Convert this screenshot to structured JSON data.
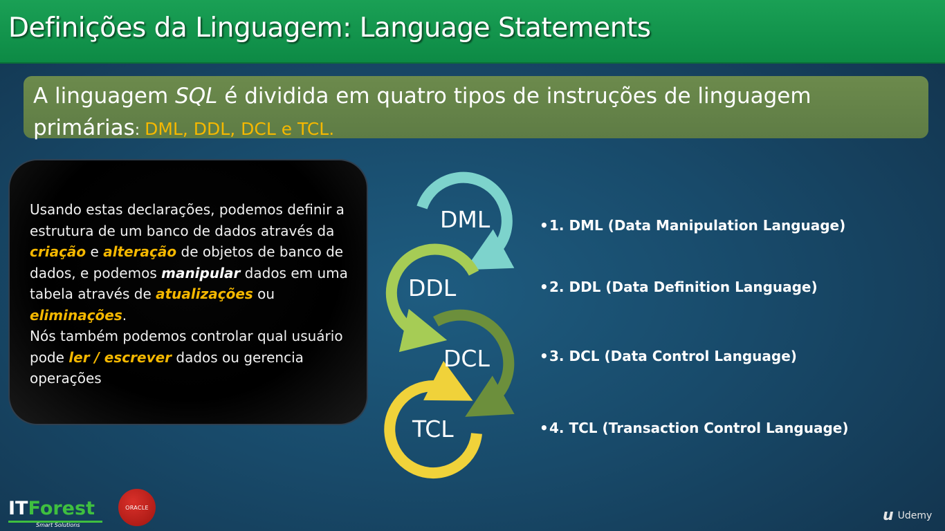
{
  "slide": {
    "title": "Definições da Linguagem: Language Statements",
    "intro": {
      "text_before": "A linguagem ",
      "sql": "SQL",
      "text_after": " é dividida em quatro tipos de instruções de linguagem primárias",
      "colon": ": ",
      "highlight": "DML, DDL, DCL e TCL."
    },
    "panel": {
      "p1": "Usando estas declarações, podemos definir a estrutura de um banco de dados através da ",
      "criacao": "criação",
      "e": " e ",
      "alteracao": "alteração",
      "p2": " de objetos de banco de dados, e podemos ",
      "manipular": "manipular",
      "p3": " dados em uma tabela através de ",
      "atualizacoes": "atualizações",
      "ou": " ou ",
      "eliminacoes": "eliminações",
      "period": ".",
      "p4": "Nós também podemos controlar qual usuário pode ",
      "ler_escrever": "ler / escrever",
      "p5": " dados ou gerencia operações"
    },
    "cycle": [
      {
        "label": "DML",
        "color": "#7dd3cc"
      },
      {
        "label": "DDL",
        "color": "#a6cc55"
      },
      {
        "label": "DCL",
        "color": "#6c8f3c"
      },
      {
        "label": "TCL",
        "color": "#f0d23a"
      }
    ],
    "bullets": [
      "1. DML (Data Manipulation Language)",
      "2. DDL (Data Definition Language)",
      "3. DCL (Data Control Language)",
      "4. TCL (Transaction Control Language)"
    ],
    "bullet_char": "•"
  },
  "footer": {
    "logo_it": "IT",
    "logo_forest": "Forest",
    "logo_sub": "Smart Solutions",
    "oracle": "ORACLE",
    "udemy": "Udemy"
  }
}
